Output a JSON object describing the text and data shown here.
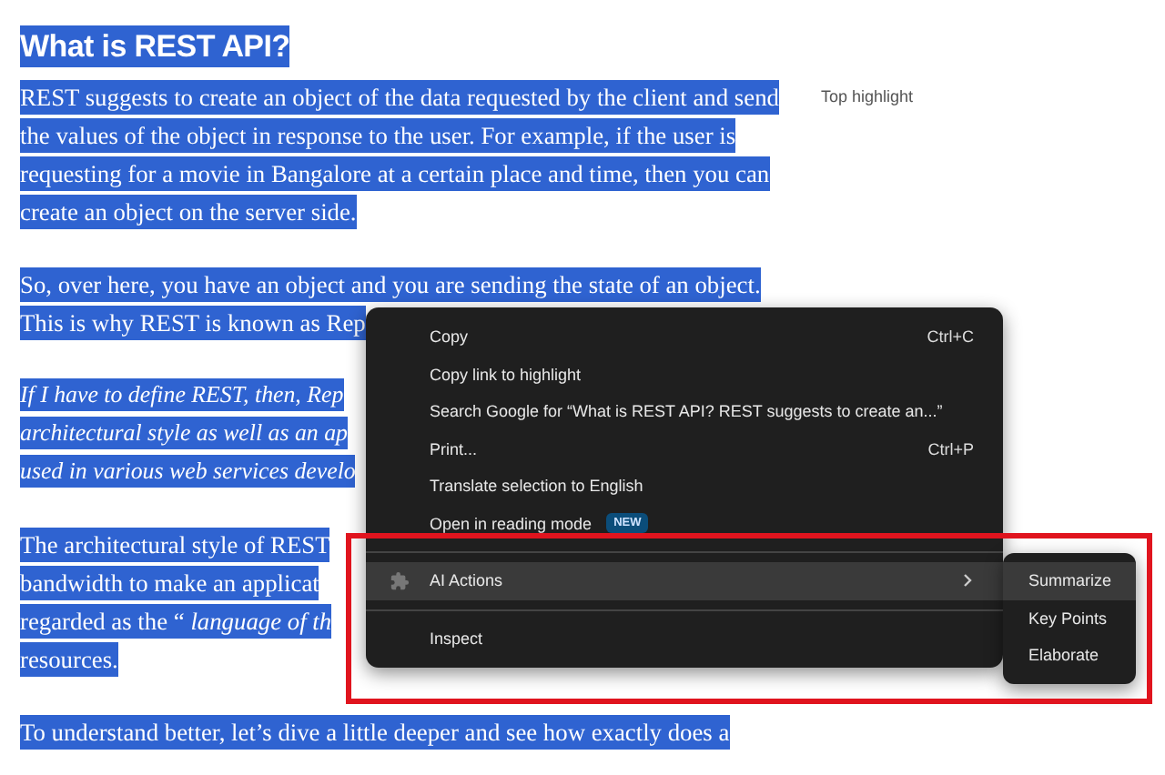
{
  "article": {
    "heading": "What is REST API?",
    "side_note": "Top highlight",
    "paragraphs": [
      {
        "italic": false,
        "lines": [
          "REST suggests to create an object of the data requested by the client and send",
          "the values of the object in response to the user. For example, if the user is",
          "requesting for a movie in Bangalore at a certain place and time, then you can",
          "create an object on the server side."
        ]
      },
      {
        "italic": false,
        "lines": [
          "So, over here, you have an object and you are sending the state of an object.",
          "This is why REST is known as Rep"
        ]
      },
      {
        "italic": true,
        "lines": [
          "If I have to define REST, then, Rep",
          "architectural style as well as an ap",
          "used in various web services develo"
        ]
      },
      {
        "italic": false,
        "lines": [
          "The architectural style of REST",
          "bandwidth to make an applicat",
          "regarded as the “ *language of th*",
          "resources."
        ]
      },
      {
        "italic": false,
        "lines": [
          "To understand better, let’s dive a little deeper and see how exactly does a"
        ]
      }
    ]
  },
  "context_menu": {
    "items": [
      {
        "kind": "item",
        "label": "Copy",
        "shortcut": "Ctrl+C",
        "selected": false
      },
      {
        "kind": "item",
        "label": "Copy link to highlight",
        "selected": false
      },
      {
        "kind": "item",
        "label": "Search Google for “What is REST API? REST suggests to create an...”",
        "selected": false
      },
      {
        "kind": "item",
        "label": "Print...",
        "shortcut": "Ctrl+P",
        "selected": false
      },
      {
        "kind": "item",
        "label": "Translate selection to English",
        "selected": false
      },
      {
        "kind": "item",
        "label": "Open in reading mode",
        "badge": "NEW",
        "selected": false
      },
      {
        "kind": "separator"
      },
      {
        "kind": "submenu",
        "label": "AI Actions",
        "selected": true
      },
      {
        "kind": "separator"
      },
      {
        "kind": "item",
        "label": "Inspect",
        "selected": false
      }
    ],
    "submenu": [
      {
        "label": "Summarize",
        "selected": true
      },
      {
        "label": "Key Points",
        "selected": false
      },
      {
        "label": "Elaborate",
        "selected": false
      }
    ]
  }
}
